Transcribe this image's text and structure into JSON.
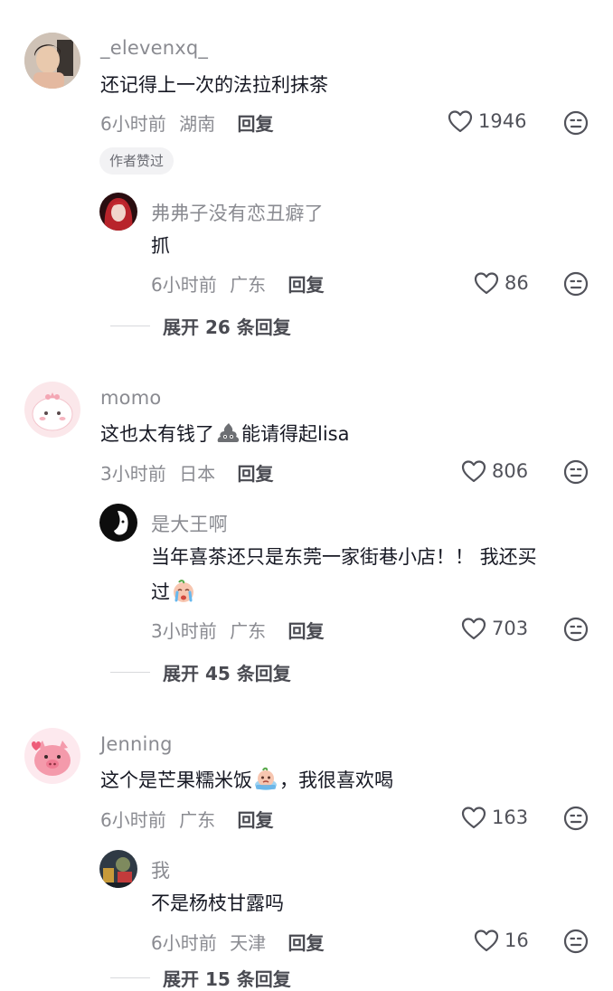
{
  "comments": [
    {
      "username": "_elevenxq_",
      "text": "还记得上一次的法拉利抹茶",
      "time": "6小时前",
      "location": "湖南",
      "reply_label": "回复",
      "likes": "1946",
      "badge": "作者赞过",
      "replies": [
        {
          "username": "弗弗子没有恋丑癖了",
          "text": "抓",
          "time": "6小时前",
          "location": "广东",
          "reply_label": "回复",
          "likes": "86"
        }
      ],
      "expand_label": "展开 26 条回复"
    },
    {
      "username": "momo",
      "text_before": "这也太有钱了",
      "text_after": "能请得起lisa",
      "emoji": "poop-emoji",
      "time": "3小时前",
      "location": "日本",
      "reply_label": "回复",
      "likes": "806",
      "replies": [
        {
          "username": "是大王啊",
          "text_line1": "当年喜茶还只是东莞一家街巷小店！！ 我还买",
          "text_line2": "过",
          "emoji": "crying-emoji",
          "time": "3小时前",
          "location": "广东",
          "reply_label": "回复",
          "likes": "703"
        }
      ],
      "expand_label": "展开 45 条回复"
    },
    {
      "username": "Jenning",
      "text_before": "这个是芒果糯米饭",
      "text_after": "，我很喜欢喝",
      "emoji": "tearful-emoji",
      "time": "6小时前",
      "location": "广东",
      "reply_label": "回复",
      "likes": "163",
      "replies": [
        {
          "username": "我",
          "text": "不是杨枝甘露吗",
          "time": "6小时前",
          "location": "天津",
          "reply_label": "回复",
          "likes": "16"
        }
      ],
      "expand_label": "展开 15 条回复"
    }
  ],
  "colors": {
    "muted": "#8a8b91",
    "text": "#161823",
    "badge_bg": "#f2f2f4"
  }
}
